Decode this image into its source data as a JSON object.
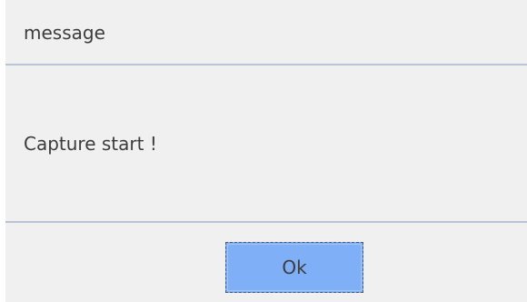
{
  "dialog": {
    "title": "message",
    "message": "Capture start !",
    "ok_label": "Ok"
  },
  "colors": {
    "background": "#f0f0f0",
    "divider": "#b7c4d6",
    "button": "#7fb0f7",
    "text": "#3c3c3c"
  }
}
